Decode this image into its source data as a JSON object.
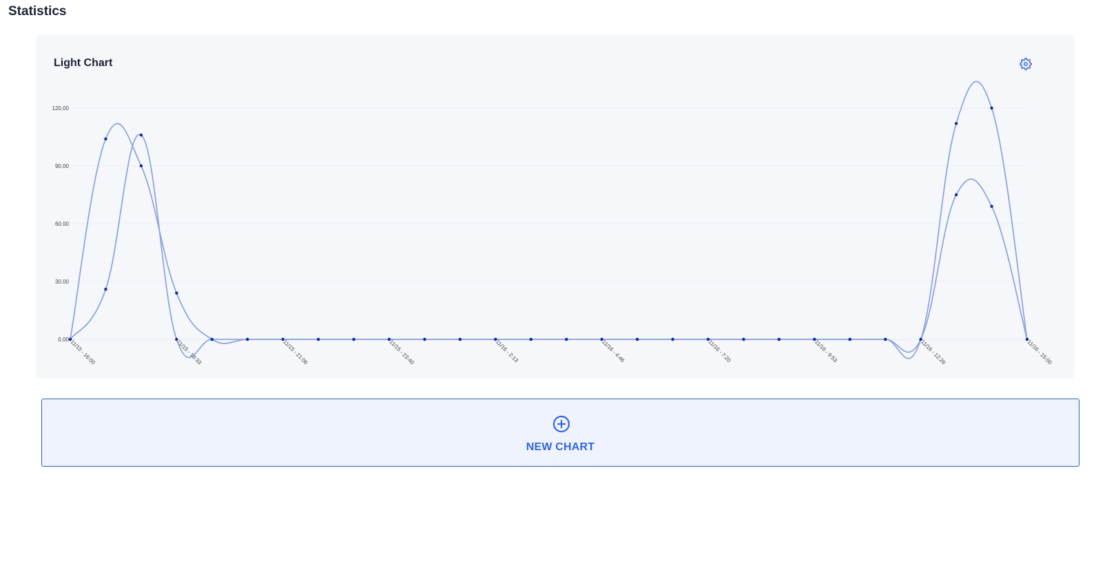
{
  "page": {
    "title": "Statistics"
  },
  "chart_card": {
    "title": "Light Chart",
    "settings_icon": "gear-icon"
  },
  "new_chart": {
    "label": "NEW CHART",
    "icon": "plus-circle-icon"
  },
  "colors": {
    "accent": "#3366dd",
    "line": "#8fa6d9",
    "point": "#0b2aa8",
    "card_bg": "#f6f7fb"
  },
  "chart_data": {
    "type": "line",
    "title": "",
    "ylim": [
      0,
      120
    ],
    "yticks": [
      "0.00",
      "30.00",
      "60.00",
      "90.00",
      "120.00"
    ],
    "x": [
      "11/15 - 16:00",
      "",
      "",
      "11/15 - 18:33",
      "",
      "",
      "11/15 - 21:06",
      "",
      "",
      "11/15 - 23:40",
      "",
      "",
      "11/16 - 2:13",
      "",
      "",
      "11/16 - 4:46",
      "",
      "",
      "11/16 - 7:20",
      "",
      "",
      "11/16 - 9:53",
      "",
      "",
      "11/16 - 12:26",
      "",
      "",
      "11/16 - 15:00"
    ],
    "xticks_shown": [
      0,
      3,
      6,
      9,
      12,
      15,
      18,
      21,
      24,
      27
    ],
    "grid": true,
    "series": [
      {
        "values": [
          0,
          104,
          90,
          24,
          0,
          0,
          0,
          0,
          0,
          0,
          0,
          0,
          0,
          0,
          0,
          0,
          0,
          0,
          0,
          0,
          0,
          0,
          0,
          0,
          0,
          75,
          69,
          0
        ]
      },
      {
        "values": [
          0,
          26,
          106,
          0,
          0,
          0,
          0,
          0,
          0,
          0,
          0,
          0,
          0,
          0,
          0,
          0,
          0,
          0,
          0,
          0,
          0,
          0,
          0,
          0,
          0,
          112,
          120,
          0
        ]
      }
    ]
  }
}
